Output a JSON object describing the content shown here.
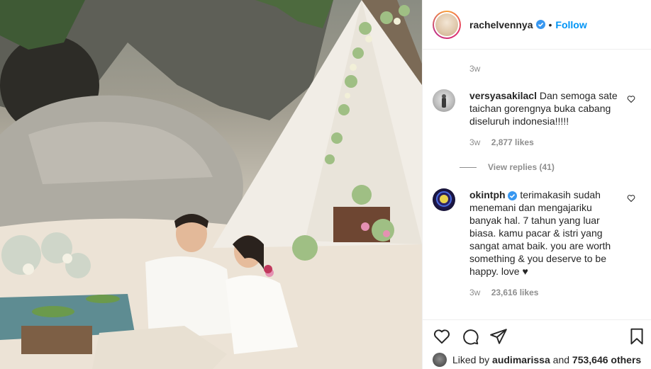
{
  "post": {
    "username": "rachelvennya",
    "follow_label": "Follow",
    "separator": "•"
  },
  "first_comment": {
    "time": "3w"
  },
  "comments": [
    {
      "username": "versyasakilacl",
      "text": "Dan semoga sate taichan gorengnya buka cabang diseluruh indonesia!!!!!",
      "time": "3w",
      "likes": "2,877 likes",
      "view_replies": "View replies (41)"
    },
    {
      "username": "okintph",
      "text": "terimakasih sudah menemani dan mengajariku banyak hal. 7 tahun yang luar biasa. kamu pacar & istri yang sangat amat baik. you are worth something & you deserve to be happy. love ♥",
      "time": "3w",
      "likes": "23,616 likes"
    }
  ],
  "likes_summary": {
    "prefix": "Liked by",
    "user": "audimarissa",
    "connector": "and",
    "others": "753,646 others"
  },
  "colors": {
    "accent": "#0095f6",
    "verified": "#3897f0",
    "muted": "#8e8e8e"
  },
  "icons": [
    "verified-icon",
    "heart-icon",
    "comment-icon",
    "share-icon",
    "bookmark-icon"
  ]
}
